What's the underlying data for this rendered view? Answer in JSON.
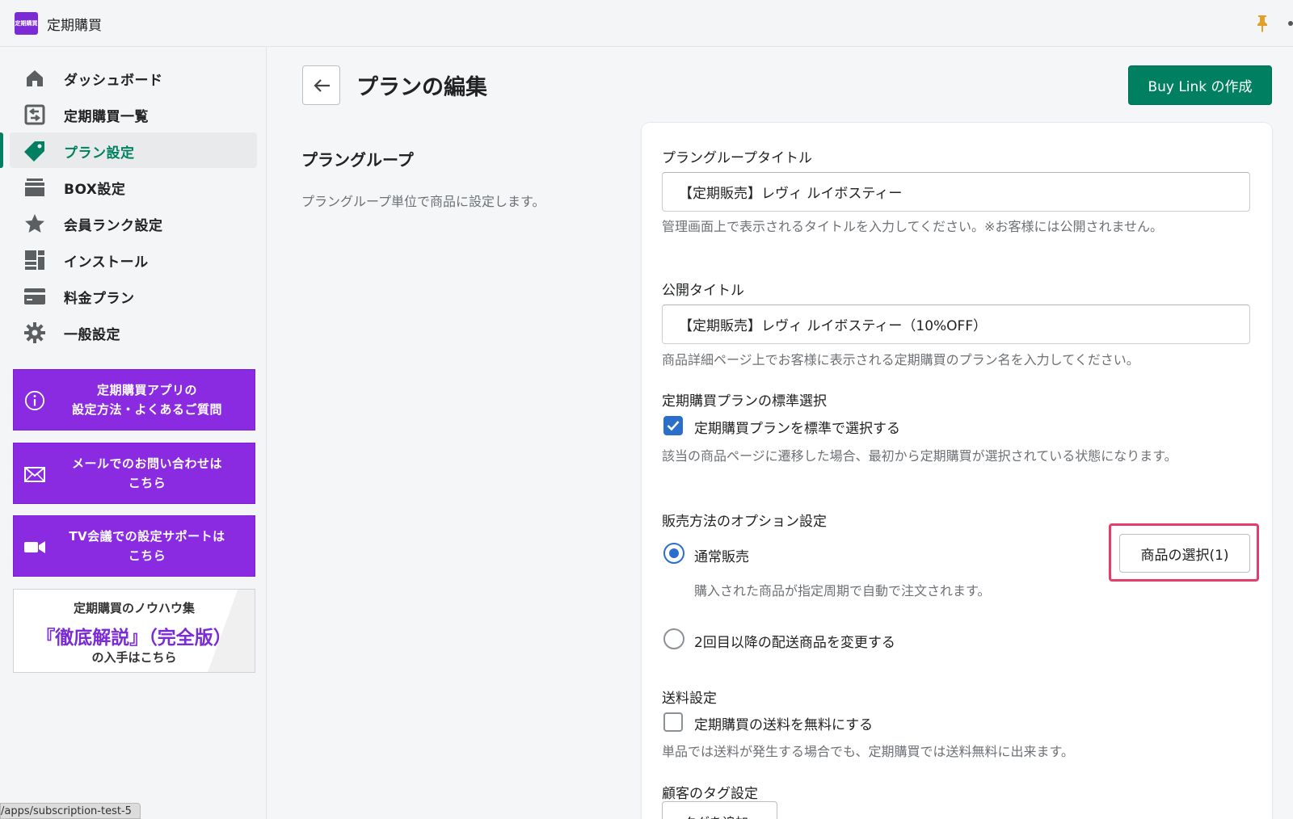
{
  "app": {
    "logo_text": "定期購買",
    "title": "定期購買"
  },
  "sidebar": {
    "items": [
      {
        "label": "ダッシュボード",
        "icon": "home-icon"
      },
      {
        "label": "定期購買一覧",
        "icon": "list-icon"
      },
      {
        "label": "プラン設定",
        "icon": "tag-icon",
        "active": true
      },
      {
        "label": "BOX設定",
        "icon": "box-icon"
      },
      {
        "label": "会員ランク設定",
        "icon": "star-icon"
      },
      {
        "label": "インストール",
        "icon": "install-icon"
      },
      {
        "label": "料金プラン",
        "icon": "credit-card-icon"
      },
      {
        "label": "一般設定",
        "icon": "gear-icon"
      }
    ],
    "promos": [
      {
        "line1": "定期購買アプリの",
        "line2": "設定方法・よくあるご質問",
        "icon": "info-icon"
      },
      {
        "line1": "メールでのお問い合わせは",
        "line2": "こちら",
        "icon": "mail-icon"
      },
      {
        "line1": "TV会議での設定サポートは",
        "line2": "こちら",
        "icon": "video-icon"
      }
    ],
    "knowhow": {
      "line1": "定期購買のノウハウ集",
      "line2": "『徹底解説』（完全版）",
      "line3": "の入手はこちら"
    }
  },
  "status_bar": {
    "url": "/apps/subscription-test-5"
  },
  "header": {
    "title": "プランの編集",
    "buy_link_label": "Buy Link の作成"
  },
  "section": {
    "title": "プラングループ",
    "description": "プラングループ単位で商品に設定します。"
  },
  "form": {
    "group_title": {
      "label": "プラングループタイトル",
      "value": "【定期販売】レヴィ ルイボスティー",
      "help": "管理画面上で表示されるタイトルを入力してください。※お客様には公開されません。"
    },
    "public_title": {
      "label": "公開タイトル",
      "value": "【定期販売】レヴィ ルイボスティー（10%OFF）",
      "help": "商品詳細ページ上でお客様に表示される定期購買のプラン名を入力してください。"
    },
    "default_select": {
      "label": "定期購買プランの標準選択",
      "checkbox_label": "定期購買プランを標準で選択する",
      "checked": true,
      "help": "該当の商品ページに遷移した場合、最初から定期購買が選択されている状態になります。"
    },
    "sales_option": {
      "label": "販売方法のオプション設定",
      "normal_label": "通常販売",
      "normal_help": "購入された商品が指定周期で自動で注文されます。",
      "change_label": "2回目以降の配送商品を変更する",
      "select_product_label": "商品の選択(1)"
    },
    "shipping": {
      "label": "送料設定",
      "checkbox_label": "定期購買の送料を無料にする",
      "checked": false,
      "help": "単品では送料が発生する場合でも、定期購買では送料無料に出来ます。"
    },
    "customer_tag": {
      "label": "顧客のタグ設定",
      "button_label": "タグを追加"
    }
  },
  "colors": {
    "primary": "#008060",
    "promo": "#8a2be2",
    "checkbox": "#2c6ecb",
    "highlight": "#e53d6b"
  }
}
